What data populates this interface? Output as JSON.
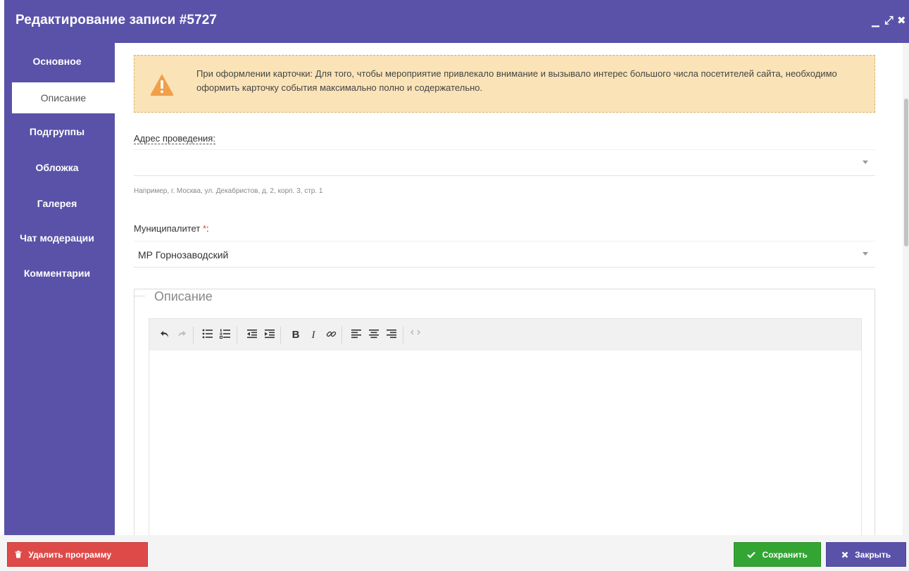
{
  "window": {
    "title": "Редактирование записи #5727",
    "minimize_glyph": "▁",
    "maximize_glyph": "⤢",
    "close_glyph": "✖"
  },
  "sidebar": {
    "items": [
      {
        "label": "Основное",
        "active": false
      },
      {
        "label": "Описание",
        "active": true
      },
      {
        "label": "Подгруппы",
        "active": false
      },
      {
        "label": "Обложка",
        "active": false
      },
      {
        "label": "Галерея",
        "active": false
      },
      {
        "label": "Чат модерации",
        "active": false
      },
      {
        "label": "Комментарии",
        "active": false
      }
    ]
  },
  "alert": {
    "icon": "warning-triangle-icon",
    "text": "При оформлении карточки: Для того, чтобы мероприятие привлекало внимание и вызывало интерес большого числа посетителей сайта, необходимо оформить карточку события максимально полно и содержательно."
  },
  "address": {
    "label": "Адрес проведения:",
    "value": "",
    "hint": "Например, г. Москва, ул. Декабристов, д. 2, корп. 3, стр. 1"
  },
  "municipality": {
    "label": "Муниципалитет",
    "required_mark": "*",
    "colon": ":",
    "value": "МР Горнозаводский"
  },
  "description": {
    "legend": "Описание",
    "toolbar": [
      "undo-icon",
      "redo-icon",
      "bullet-list-icon",
      "numbered-list-icon",
      "outdent-icon",
      "indent-icon",
      "bold-icon",
      "italic-icon",
      "link-icon",
      "align-left-icon",
      "align-center-icon",
      "align-right-icon",
      "source-code-icon"
    ],
    "bold_glyph": "B",
    "italic_glyph": "I"
  },
  "footer": {
    "delete_label": "Удалить программу",
    "save_label": "Сохранить",
    "close_label": "Закрыть"
  },
  "colors": {
    "accent": "#5a52a8",
    "danger": "#dd4a48",
    "success": "#33a533",
    "warning_bg": "#fbe3b8",
    "warning_icon": "#f0a04a"
  }
}
